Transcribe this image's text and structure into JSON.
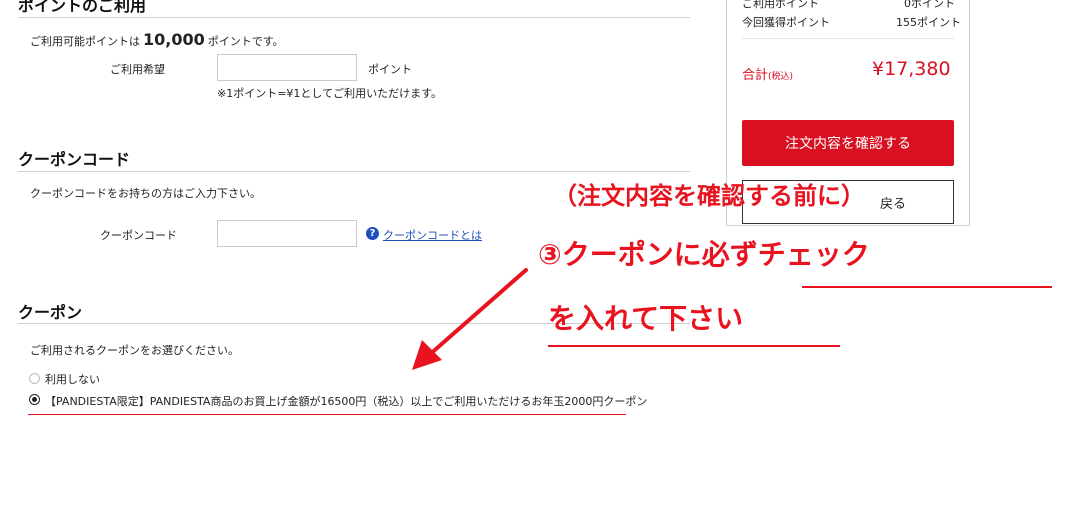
{
  "points": {
    "title": "ポイントのご利用",
    "available_prefix": "ご利用可能ポイントは",
    "available_value": "10,000",
    "available_suffix": "ポイントです。",
    "use_label": "ご利用希望",
    "use_value": "",
    "unit": "ポイント",
    "note": "※1ポイント=¥1としてご利用いただけます。"
  },
  "coupon_code": {
    "title": "クーポンコード",
    "description": "クーポンコードをお持ちの方はご入力下さい。",
    "label": "クーポンコード",
    "value": "",
    "help_icon": "question-mark",
    "help_link": "クーポンコードとは"
  },
  "coupon": {
    "title": "クーポン",
    "description": "ご利用されるクーポンをお選びください。",
    "options": [
      {
        "label": "利用しない",
        "checked": false
      },
      {
        "label": "【PANDIESTA限定】PANDIESTA商品のお買上げ金額が16500円（税込）以上でご利用いただけるお年玉2000円クーポン",
        "checked": true
      }
    ]
  },
  "summary": {
    "used_points_label": "ご利用ポイント",
    "used_points_value": "0ポイント",
    "earned_points_label": "今回獲得ポイント",
    "earned_points_value": "155ポイント",
    "total_label": "合計",
    "total_tax": "(税込)",
    "total_value": "¥17,380",
    "confirm_button": "注文内容を確認する",
    "back_button": "戻る"
  },
  "annotation": {
    "line1": "（注文内容を確認する前に）",
    "line2": "③クーポンに必ずチェック",
    "line3": "を入れて下さい",
    "color": "#e8131e"
  }
}
